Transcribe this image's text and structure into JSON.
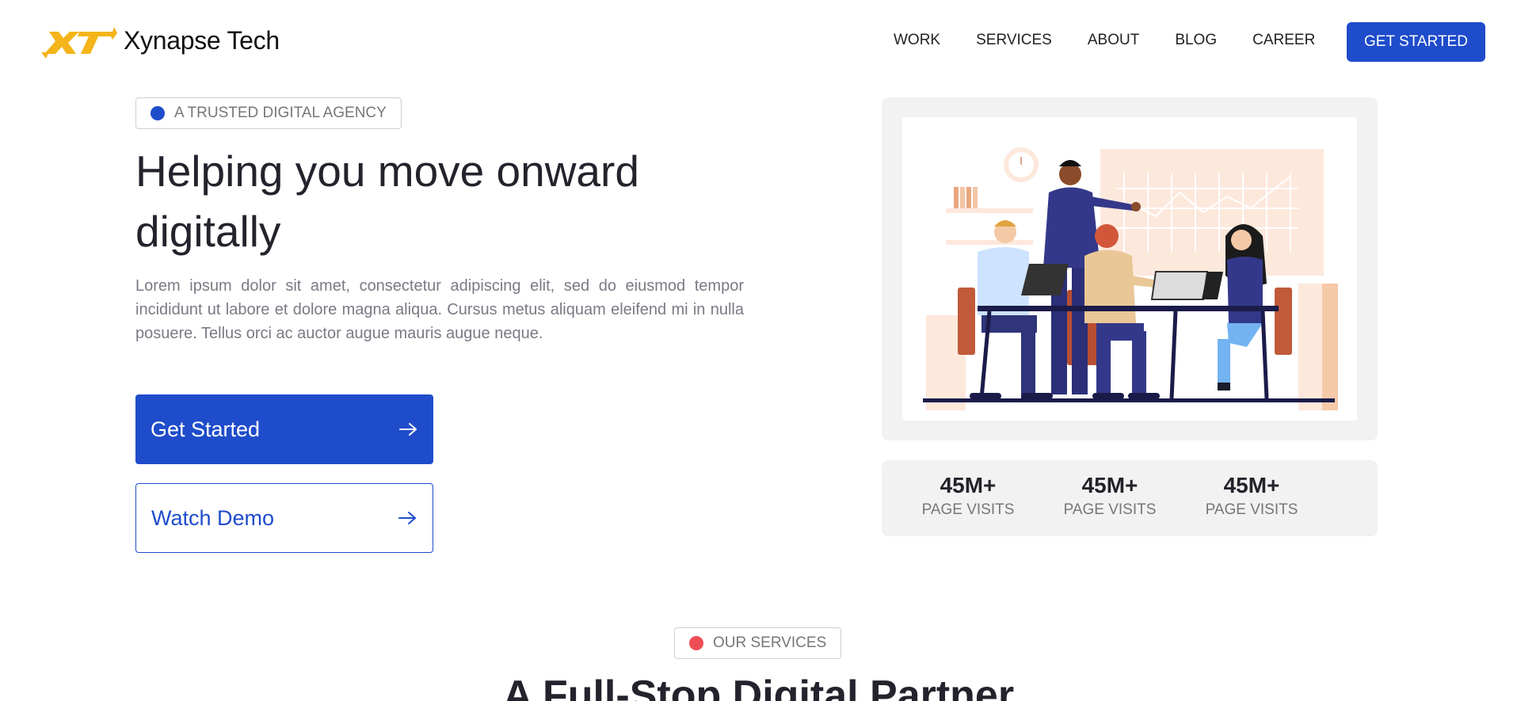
{
  "brand": {
    "name": "Xynapse Tech",
    "logo_mark": "XT",
    "accent_color": "#1f4ccb",
    "logo_color": "#f4b41a"
  },
  "nav": {
    "items": [
      {
        "label": "WORK"
      },
      {
        "label": "SERVICES"
      },
      {
        "label": "ABOUT"
      },
      {
        "label": "BLOG"
      },
      {
        "label": "CAREER"
      }
    ],
    "cta_label": "GET STARTED"
  },
  "hero": {
    "badge": "A TRUSTED DIGITAL AGENCY",
    "title": "Helping you move onward digitally",
    "description": "Lorem ipsum dolor sit amet, consectetur adipiscing elit, sed do eiusmod tempor incididunt ut labore et dolore magna aliqua. Cursus metus aliquam eleifend mi in nulla posuere. Tellus orci ac auctor augue mauris augue neque.",
    "primary_button": {
      "label": "Get Started",
      "icon": "arrow-right-icon"
    },
    "secondary_button": {
      "label": "Watch Demo",
      "icon": "arrow-right-icon"
    },
    "illustration": "team-meeting-illustration"
  },
  "stats": [
    {
      "value": "45M+",
      "label": "PAGE VISITS"
    },
    {
      "value": "45M+",
      "label": "PAGE VISITS"
    },
    {
      "value": "45M+",
      "label": "PAGE VISITS"
    }
  ],
  "services": {
    "badge": "OUR SERVICES",
    "badge_dot_color": "#ee4d55",
    "title": "A Full-Stop Digital Partner"
  }
}
